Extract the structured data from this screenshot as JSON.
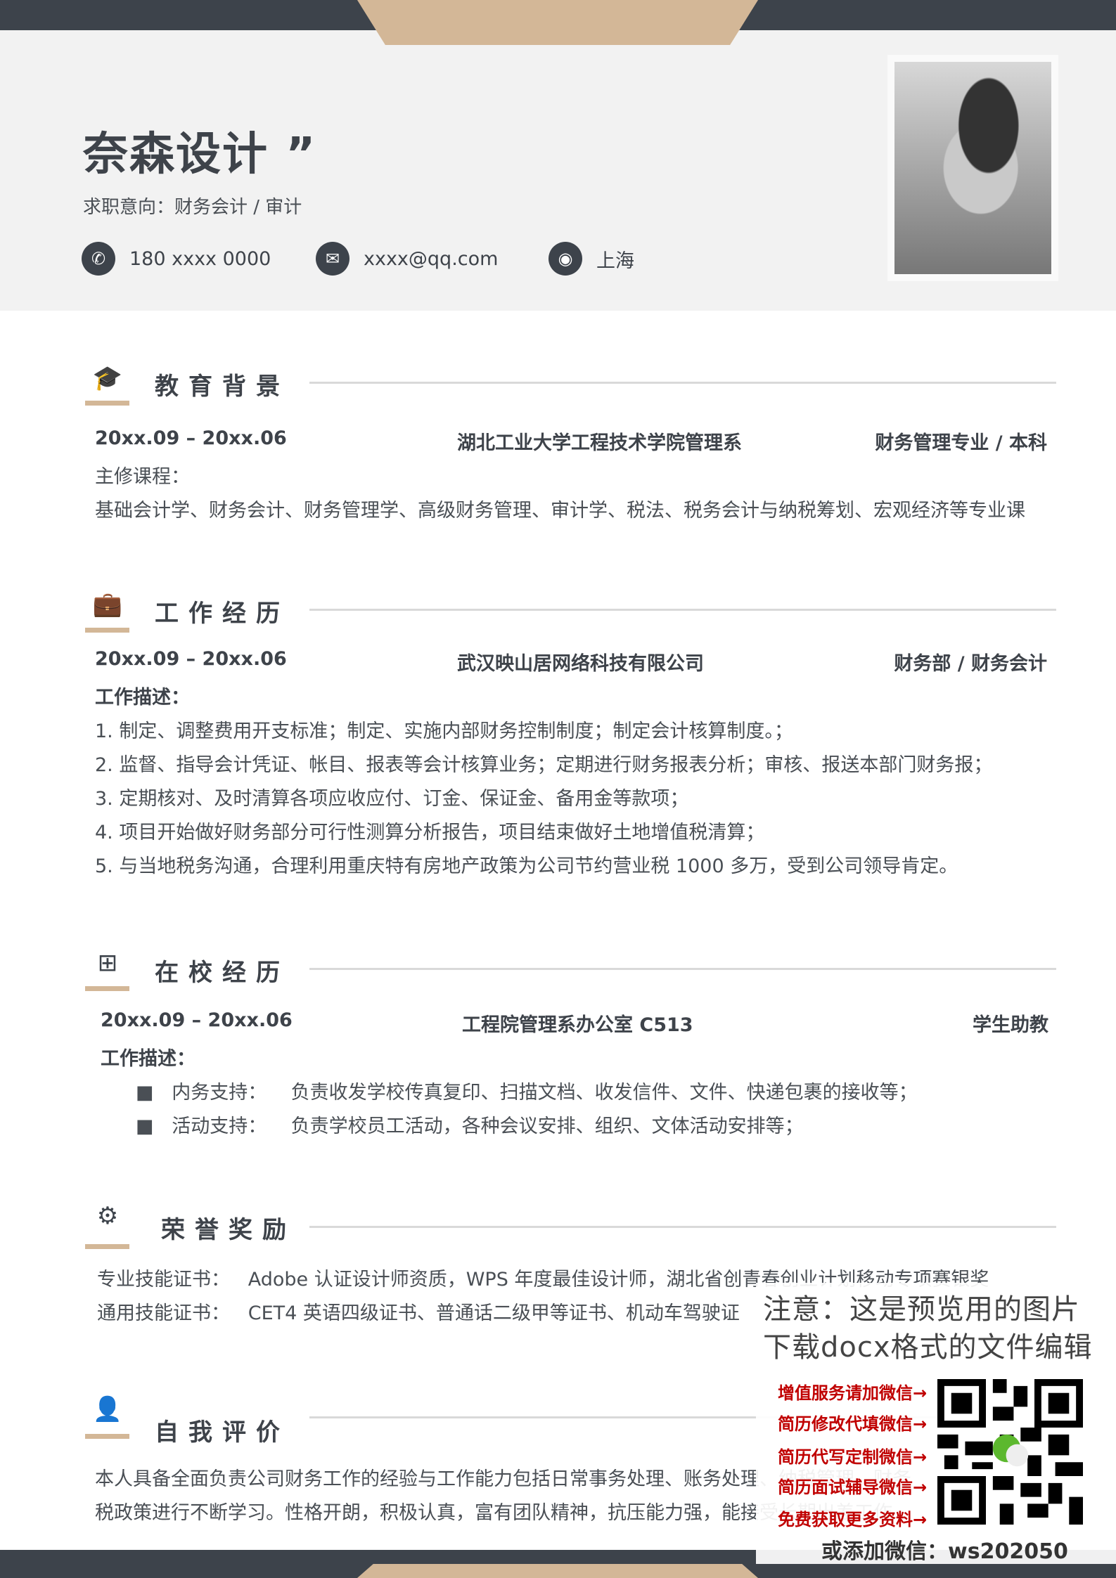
{
  "header": {
    "name": "奈森设计 ”",
    "intent": "求职意向：财务会计 / 审计",
    "phone": "180 xxxx 0000",
    "email": "xxxx@qq.com",
    "city": "上海"
  },
  "education": {
    "title": "教育背景",
    "date": "20xx.09 – 20xx.06",
    "school": "湖北工业大学工程技术学院管理系",
    "major": "财务管理专业 / 本科",
    "course_label": "主修课程：",
    "courses": "基础会计学、财务会计、财务管理学、高级财务管理、审计学、税法、税务会计与纳税筹划、宏观经济等专业课"
  },
  "work": {
    "title": "工作经历",
    "date": "20xx.09 – 20xx.06",
    "company": "武汉映山居网络科技有限公司",
    "role": "财务部 / 财务会计",
    "desc_label": "工作描述：",
    "items": [
      "1. 制定、调整费用开支标准；制定、实施内部财务控制制度；制定会计核算制度。；",
      "2. 监督、指导会计凭证、帐目、报表等会计核算业务；定期进行财务报表分析；审核、报送本部门财务报；",
      "3. 定期核对、及时清算各项应收应付、订金、保证金、备用金等款项；",
      "4. 项目开始做好财务部分可行性测算分析报告，项目结束做好土地增值税清算；",
      "5. 与当地税务沟通，合理利用重庆特有房地产政策为公司节约营业税 1000 多万，受到公司领导肯定。"
    ]
  },
  "campus": {
    "title": "在校经历",
    "date": "20xx.09 – 20xx.06",
    "place": "工程院管理系办公室 C513",
    "role": "学生助教",
    "desc_label": "工作描述：",
    "items": [
      {
        "k": "内务支持：",
        "v": "负责收发学校传真复印、扫描文档、收发信件、文件、快递包裹的接收等；"
      },
      {
        "k": "活动支持：",
        "v": "负责学校员工活动，各种会议安排、组织、文体活动安排等；"
      }
    ]
  },
  "honors": {
    "title": "荣誉奖励",
    "rows": [
      {
        "k": "专业技能证书：",
        "v": "Adobe 认证设计师资质，WPS 年度最佳设计师，湖北省创青春创业计划移动专项赛银奖"
      },
      {
        "k": "通用技能证书：",
        "v": "CET4  英语四级证书、普通话二级甲等证书、机动车驾驶证"
      }
    ]
  },
  "self": {
    "title": "自我评价",
    "lines": [
      "本人具备全面负责公司财务工作的经验与工作能力包括日常事务处理、账务处理、纳税管理、财务",
      "税政策进行不断学习。性格开朗，积极认真，富有团队精神，抗压能力强，能接受长期出差工作"
    ]
  },
  "watermark": {
    "line1": "注意：这是预览用的图片",
    "line2": "下载docx格式的文件编辑",
    "services": [
      "增值服务请加微信→",
      "简历修改代填微信→",
      "简历代写定制微信→",
      "简历面试辅导微信→",
      "免费获取更多资料→"
    ],
    "wechat": "或添加微信：ws202050"
  }
}
